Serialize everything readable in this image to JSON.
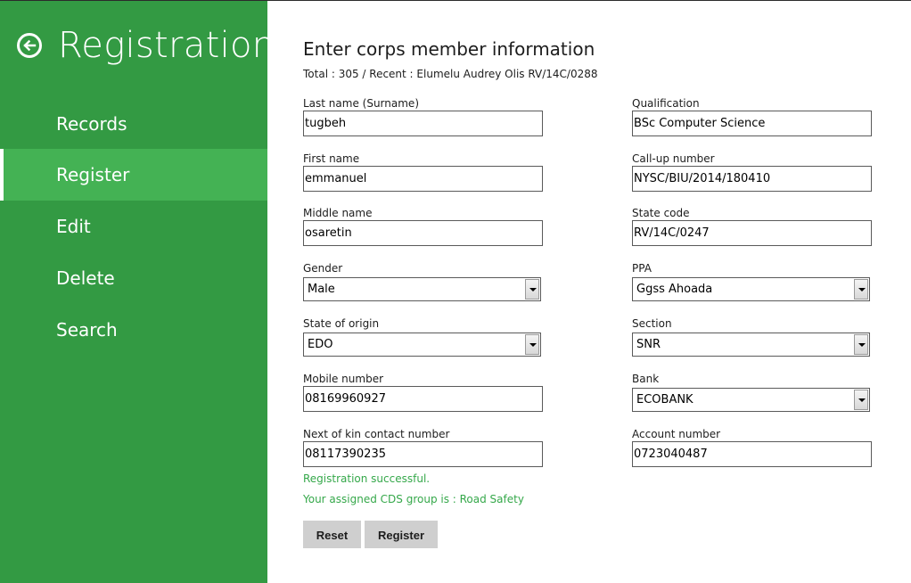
{
  "sidebar": {
    "title": "Registration",
    "items": [
      {
        "label": "Records"
      },
      {
        "label": "Register"
      },
      {
        "label": "Edit"
      },
      {
        "label": "Delete"
      },
      {
        "label": "Search"
      }
    ],
    "active_item": "Register"
  },
  "form": {
    "heading": "Enter corps member information",
    "subheading": "Total : 305 / Recent : Elumelu Audrey Olis RV/14C/0288",
    "fields": {
      "last_name": {
        "label": "Last name (Surname)",
        "value": "tugbeh"
      },
      "first_name": {
        "label": "First name",
        "value": "emmanuel"
      },
      "middle_name": {
        "label": "Middle name",
        "value": "osaretin"
      },
      "gender": {
        "label": "Gender",
        "value": "Male"
      },
      "state_of_origin": {
        "label": "State of origin",
        "value": "EDO"
      },
      "mobile_number": {
        "label": "Mobile number",
        "value": "08169960927"
      },
      "next_of_kin": {
        "label": "Next of kin contact number",
        "value": "08117390235"
      },
      "qualification": {
        "label": "Qualification",
        "value": "BSc Computer Science"
      },
      "call_up_number": {
        "label": "Call-up number",
        "value": "NYSC/BIU/2014/180410"
      },
      "state_code": {
        "label": "State code",
        "value": "RV/14C/0247"
      },
      "ppa": {
        "label": "PPA",
        "value": "Ggss Ahoada"
      },
      "section": {
        "label": "Section",
        "value": "SNR"
      },
      "bank": {
        "label": "Bank",
        "value": "ECOBANK"
      },
      "account_number": {
        "label": "Account number",
        "value": "0723040487"
      }
    },
    "status_message": "Registration successful.",
    "cds_message": "Your assigned CDS group is : Road Safety",
    "buttons": {
      "reset": "Reset",
      "register": "Register"
    }
  },
  "colors": {
    "sidebar_bg": "#339a43",
    "sidebar_active": "#44b254",
    "success_text": "#35a84a",
    "button_bg": "#cfcfcf"
  },
  "icons": {
    "back": "back-arrow-circle-icon",
    "dropdown": "chevron-down-icon"
  }
}
